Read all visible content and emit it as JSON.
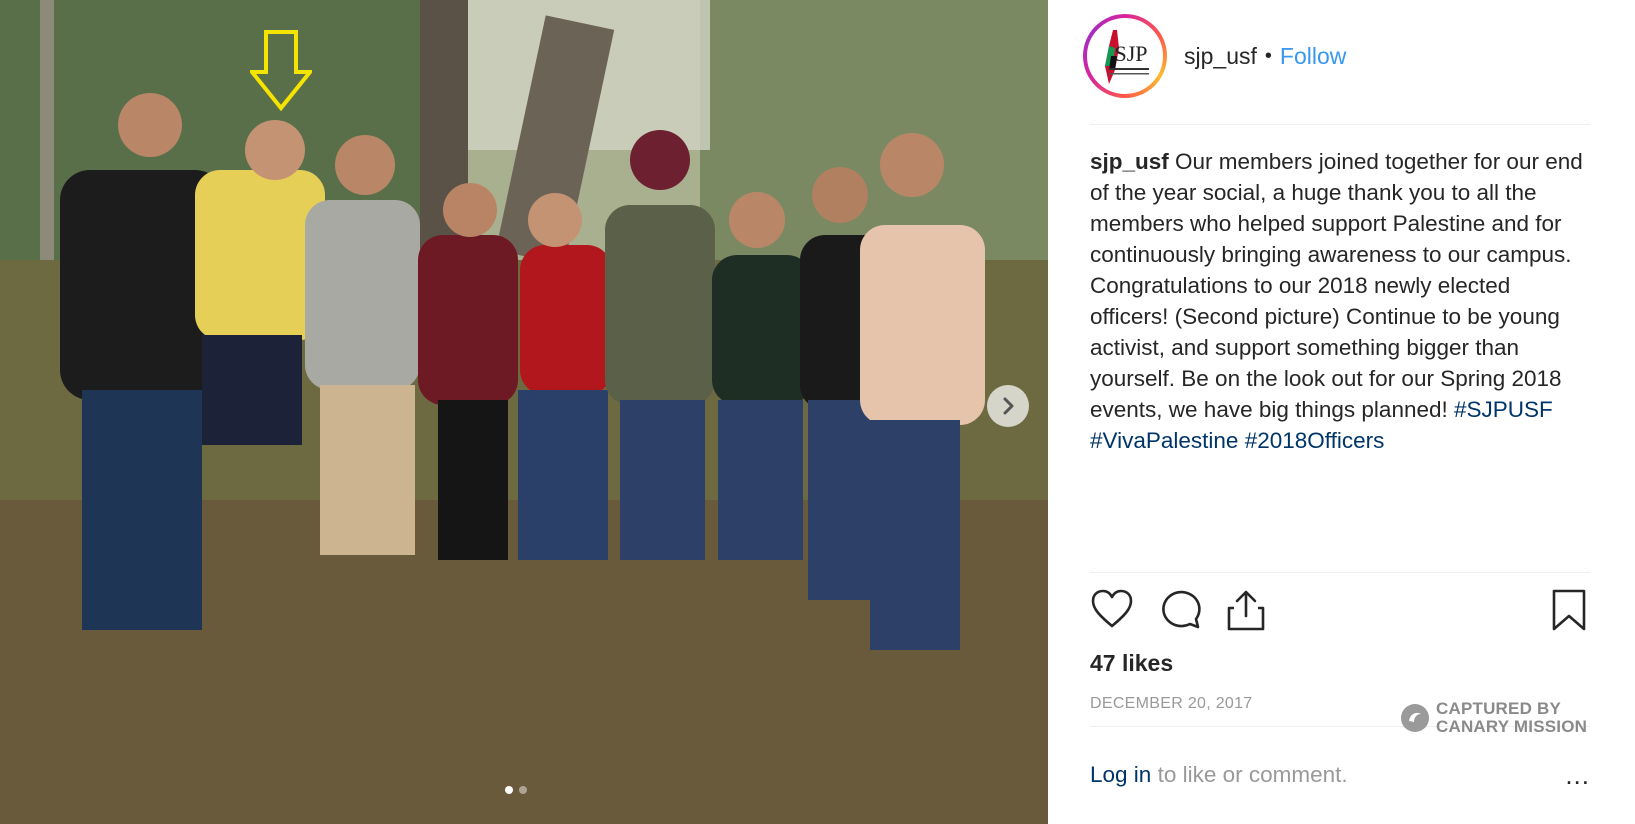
{
  "post": {
    "photo_alt": "Group photo of nine people standing outdoors",
    "carousel": {
      "slide_count": 2,
      "active_index": 0
    }
  },
  "header": {
    "avatar_text": "SJP",
    "username": "sjp_usf",
    "separator": "•",
    "follow_label": "Follow"
  },
  "caption": {
    "username": "sjp_usf",
    "text": " Our members joined together for our end of the year social, a huge thank you to all the members who helped support Palestine and for continuously bringing awareness to our campus. Congratulations to our 2018 newly elected officers! (Second picture) Continue to be young activist, and support something bigger than yourself. Be on the look out for our Spring 2018 events, we have big things planned! ",
    "hashtags": [
      "#SJPUSF",
      "#VivaPalestine",
      "#2018Officers"
    ]
  },
  "actions": {
    "like_icon": "heart-icon",
    "comment_icon": "comment-icon",
    "share_icon": "share-icon",
    "save_icon": "bookmark-icon"
  },
  "likes": "47 likes",
  "date": "DECEMBER 20, 2017",
  "watermark": {
    "line1": "CAPTURED BY",
    "line2": "CANARY MISSION"
  },
  "login": {
    "link": "Log in",
    "rest": " to like or comment.",
    "more": "..."
  },
  "colors": {
    "link_blue": "#3897f0",
    "hashtag_blue": "#003569",
    "marker_yellow": "#f5e400"
  }
}
